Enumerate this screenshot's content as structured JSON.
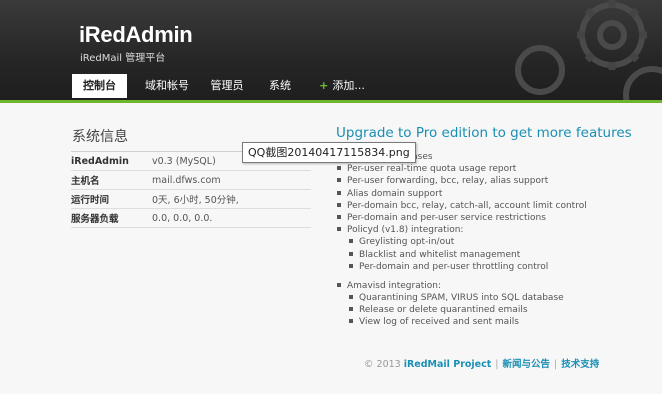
{
  "header": {
    "title": "iRedAdmin",
    "subtitle": "iRedMail 管理平台"
  },
  "nav": {
    "tabs": [
      {
        "label": "控制台",
        "active": true
      },
      {
        "label": "域和帐号"
      },
      {
        "label": "管理员"
      },
      {
        "label": "系统"
      },
      {
        "label": "添加..."
      }
    ]
  },
  "system_info": {
    "title": "系统信息",
    "rows": [
      {
        "key": "iRedAdmin",
        "value": "v0.3 (MySQL)"
      },
      {
        "key": "主机名",
        "value": "mail.dfws.com"
      },
      {
        "key": "运行时间",
        "value": "0天, 6小时, 50分钟,"
      },
      {
        "key": "服务器负载",
        "value": "0.0, 0.0, 0.0."
      }
    ]
  },
  "upgrade": {
    "title": "Upgrade to Pro edition to get more features",
    "items": [
      {
        "text": "of mail lists/aliases",
        "level": 0
      },
      {
        "text": "Per-user real-time quota usage report",
        "level": 0
      },
      {
        "text": "Per-user forwarding, bcc, relay, alias support",
        "level": 0
      },
      {
        "text": "Alias domain support",
        "level": 0
      },
      {
        "text": "Per-domain bcc, relay, catch-all, account limit control",
        "level": 0
      },
      {
        "text": "Per-domain and per-user service restrictions",
        "level": 0
      },
      {
        "text": "Policyd (v1.8) integration:",
        "level": 0
      },
      {
        "text": "Greylisting opt-in/out",
        "level": 1
      },
      {
        "text": "Blacklist and whitelist management",
        "level": 1
      },
      {
        "text": "Per-domain and per-user throttling control",
        "level": 1
      },
      {
        "text": "",
        "level": -1
      },
      {
        "text": "Amavisd integration:",
        "level": 0
      },
      {
        "text": "Quarantining SPAM, VIRUS into SQL database",
        "level": 1
      },
      {
        "text": "Release or delete quarantined emails",
        "level": 1
      },
      {
        "text": "View log of received and sent mails",
        "level": 1
      }
    ]
  },
  "footer": {
    "copyright": "© 2013",
    "project": "iRedMail Project",
    "news": "新闻与公告",
    "support": "技术支持"
  },
  "tooltip": {
    "text": "QQ截图20140417115834.png"
  },
  "colors": {
    "accent": "#1a8fb5",
    "green_bar": "#6cb52d",
    "header_bg": "#2a2a2a"
  }
}
